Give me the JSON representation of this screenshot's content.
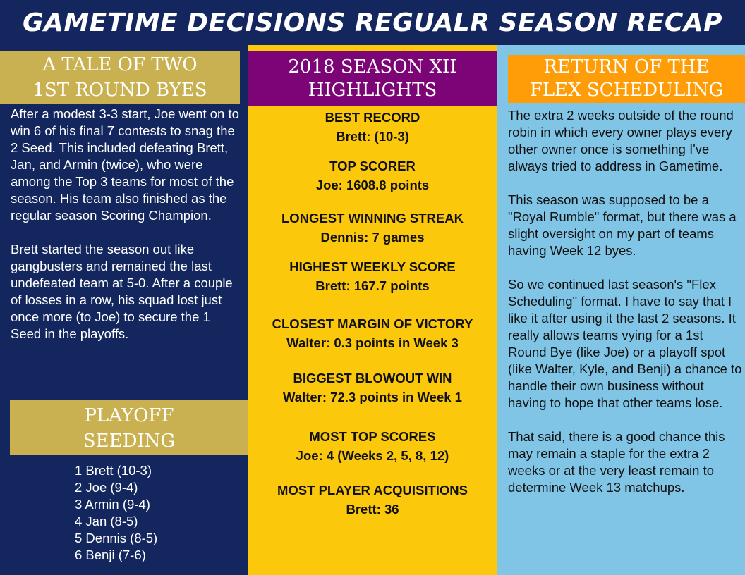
{
  "title": "GAMETIME DECISIONS REGUALR SEASON RECAP",
  "colors": {
    "navy": "#13275e",
    "gold": "#c9b152",
    "yellow": "#fbc80c",
    "purple": "#7d0477",
    "light_blue": "#80c5e6",
    "orange": "#fe9d07"
  },
  "left": {
    "header_line1": "A TALE OF TWO",
    "header_line2": "1ST ROUND BYES",
    "paragraph1": "After a modest 3-3 start, Joe went on to win 6 of his final 7 contests to snag the 2 Seed. This included defeating Brett, Jan, and Armin (twice), who were among the Top 3 teams for most of the season.  His team also finished as the regular season Scoring Champion.",
    "paragraph2": "Brett started the season out like gangbusters and remained the last undefeated team at 5-0. After a couple of losses in a row, his squad lost just once more (to Joe) to secure the 1 Seed in the playoffs."
  },
  "seeding": {
    "header_line1": "PLAYOFF",
    "header_line2": "SEEDING",
    "items": [
      "1 Brett (10-3)",
      "2 Joe (9-4)",
      "3 Armin (9-4)",
      "4 Jan (8-5)",
      "5 Dennis (8-5)",
      "6 Benji (7-6)"
    ]
  },
  "highlights": {
    "header_line1": "2018 SEASON XII",
    "header_line2": "HIGHLIGHTS",
    "items": [
      {
        "label": "BEST RECORD",
        "value": "Brett: (10-3)"
      },
      {
        "label": "TOP SCORER",
        "value": "Joe: 1608.8 points"
      },
      {
        "label": "LONGEST WINNING STREAK",
        "value": "Dennis: 7 games"
      },
      {
        "label": "HIGHEST WEEKLY SCORE",
        "value": "Brett: 167.7 points"
      },
      {
        "label": "CLOSEST MARGIN OF VICTORY",
        "value": "Walter: 0.3 points in Week 3"
      },
      {
        "label": "BIGGEST BLOWOUT WIN",
        "value": "Walter: 72.3 points in Week 1"
      },
      {
        "label": "MOST TOP SCORES",
        "value": "Joe: 4 (Weeks 2, 5, 8, 12)"
      },
      {
        "label": "MOST PLAYER ACQUISITIONS",
        "value": "Brett: 36"
      }
    ]
  },
  "right": {
    "header_line1": "RETURN OF THE",
    "header_line2": "FLEX SCHEDULING",
    "paragraph1": "The extra 2 weeks outside of the round robin in which every owner plays every other owner once is something I've always tried to address in Gametime.",
    "paragraph2": "This season was supposed to be a \"Royal Rumble\" format, but there was a slight oversight on my part of teams having Week 12 byes.",
    "paragraph3": "So we continued last season's \"Flex Scheduling\" format. I have to say that I like it after using it the last 2 seasons. It really allows teams vying for a 1st Round Bye (like Joe) or a playoff spot (like Walter, Kyle, and Benji) a chance to handle their own business without having to hope that other teams lose.",
    "paragraph4": "That said, there is a good chance this may remain a staple for the extra 2 weeks or at the very least remain to determine Week 13 matchups."
  }
}
